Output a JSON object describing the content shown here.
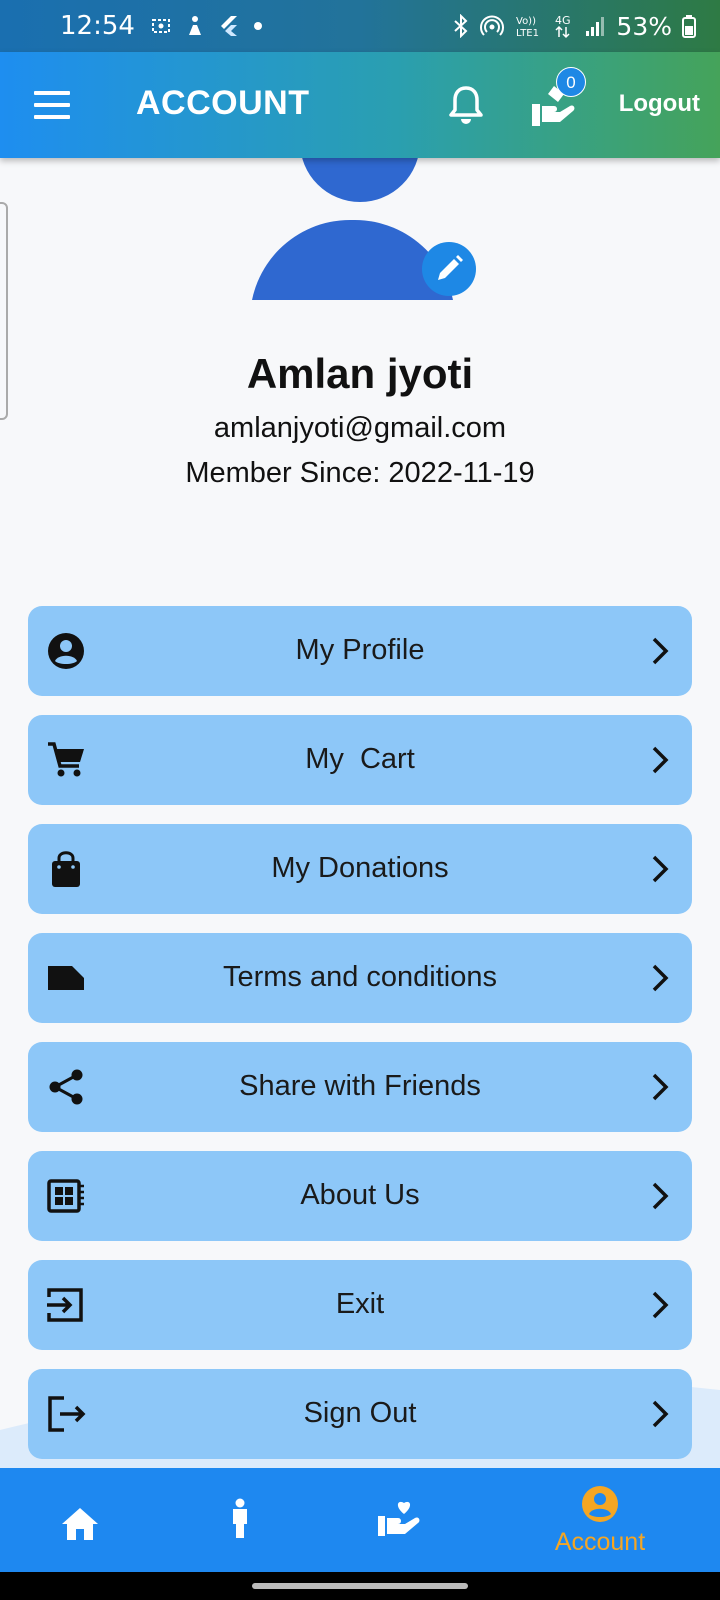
{
  "status_bar": {
    "time": "12:54",
    "battery": "53%",
    "icons": [
      "screen-record-icon",
      "user-accessibility-icon",
      "flutter-icon",
      "dot-icon",
      "bluetooth-icon",
      "hotspot-icon",
      "volte-icon",
      "4g-icon",
      "signal-icon",
      "battery-icon"
    ]
  },
  "app_bar": {
    "title": "ACCOUNT",
    "badge_count": "0",
    "logout_label": "Logout",
    "colors": {
      "gradient_start": "#1e8ef0",
      "gradient_end": "#45a35a"
    }
  },
  "profile": {
    "name": "Amlan jyoti",
    "email": "amlanjyoti@gmail.com",
    "member_since": "Member Since: 2022-11-19",
    "avatar_color": "#2f68d0"
  },
  "menu": {
    "items": [
      {
        "label": "My Profile",
        "icon": "account-circle-icon"
      },
      {
        "label": "My  Cart",
        "icon": "cart-icon"
      },
      {
        "label": "My Donations",
        "icon": "shopping-bag-icon"
      },
      {
        "label": "Terms and conditions",
        "icon": "label-icon"
      },
      {
        "label": "Share with Friends",
        "icon": "share-icon"
      },
      {
        "label": "About Us",
        "icon": "newspaper-icon"
      },
      {
        "label": "Exit",
        "icon": "exit-to-app-icon"
      },
      {
        "label": "Sign Out",
        "icon": "logout-icon"
      }
    ],
    "item_color": "#8dc7f8"
  },
  "bottom_nav": {
    "items": [
      {
        "icon": "home-icon"
      },
      {
        "icon": "person-icon"
      },
      {
        "icon": "donate-heart-icon"
      },
      {
        "icon": "account-circle-icon",
        "label": "Account",
        "active": true
      }
    ],
    "active_color": "#f5a623"
  }
}
